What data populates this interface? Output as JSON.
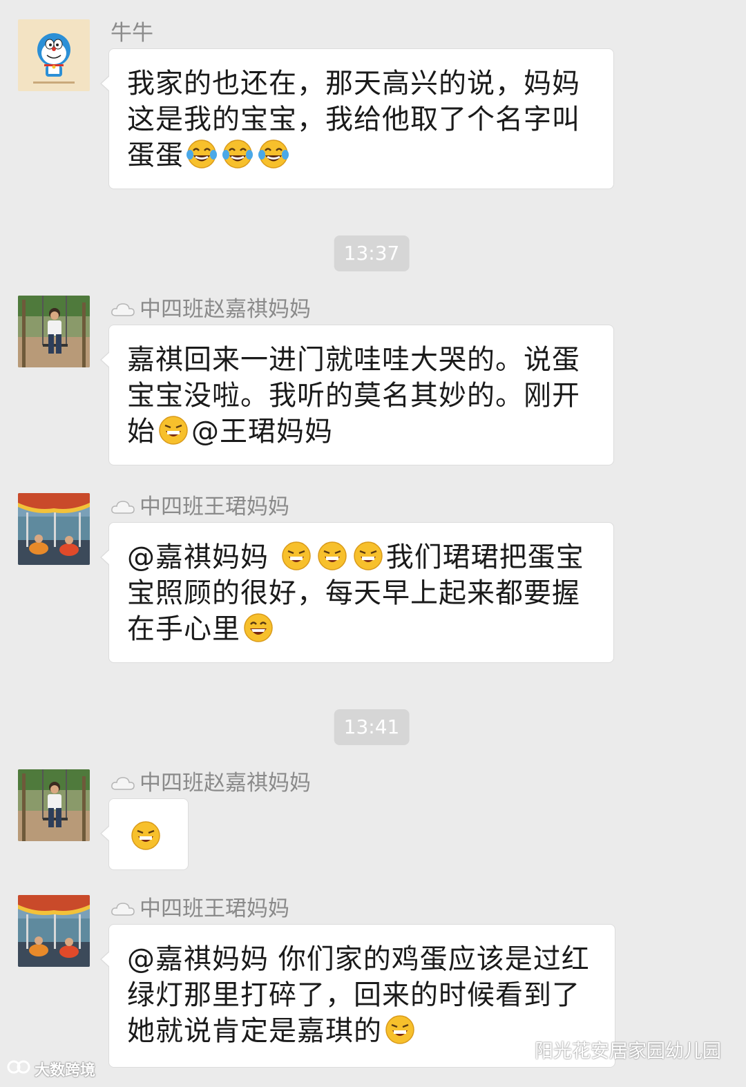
{
  "messages": [
    {
      "sender": "牛牛",
      "avatar": "doraemon-avatar",
      "lines": [
        [
          {
            "t": "我家的也还在，那天高兴的说，妈妈"
          }
        ],
        [
          {
            "t": "这是我的宝宝，我给他取了个名字叫"
          }
        ],
        [
          {
            "t": "蛋蛋"
          },
          {
            "e": "tears-of-joy-emoji"
          },
          {
            "e": "tears-of-joy-emoji"
          },
          {
            "e": "tears-of-joy-emoji"
          }
        ]
      ]
    },
    {
      "sender": "中四班赵嘉祺妈妈",
      "avatar": "child-on-swing-photo",
      "lines": [
        [
          {
            "t": "嘉祺回来一进门就哇哇大哭的。说蛋"
          }
        ],
        [
          {
            "t": "宝宝没啦。我听的莫名其妙的。刚开"
          }
        ],
        [
          {
            "t": "始"
          },
          {
            "e": "grin-emoji"
          },
          {
            "t": "@王珺妈妈"
          }
        ]
      ]
    },
    {
      "sender": "中四班王珺妈妈",
      "avatar": "carousel-photo",
      "lines": [
        [
          {
            "t": "@嘉祺妈妈 "
          },
          {
            "e": "grin-emoji"
          },
          {
            "e": "grin-emoji"
          },
          {
            "e": "grin-emoji"
          },
          {
            "t": "我们珺珺把蛋宝"
          }
        ],
        [
          {
            "t": "宝照顾的很好，每天早上起来都要握"
          }
        ],
        [
          {
            "t": "在手心里"
          },
          {
            "e": "smile-emoji"
          }
        ]
      ]
    },
    {
      "sender": "中四班赵嘉祺妈妈",
      "avatar": "child-on-swing-photo",
      "lines": [
        [
          {
            "e": "grin-emoji"
          }
        ]
      ]
    },
    {
      "sender": "中四班王珺妈妈",
      "avatar": "carousel-photo",
      "lines": [
        [
          {
            "t": "@嘉祺妈妈 你们家的鸡蛋应该是过红"
          }
        ],
        [
          {
            "t": "绿灯那里打碎了，回来的时候看到了"
          }
        ],
        [
          {
            "t": "她就说肯定是嘉琪的"
          },
          {
            "e": "grin-emoji"
          }
        ]
      ]
    }
  ],
  "timestamps": [
    "13:37",
    "13:41"
  ],
  "watermarks": {
    "left": "大数跨境",
    "right": "阳光花安居家园幼儿园"
  },
  "colors": {
    "background": "#ebebeb",
    "bubble": "#ffffff",
    "sender_text": "#8a8a8a",
    "time_pill": "#d6d6d6"
  }
}
